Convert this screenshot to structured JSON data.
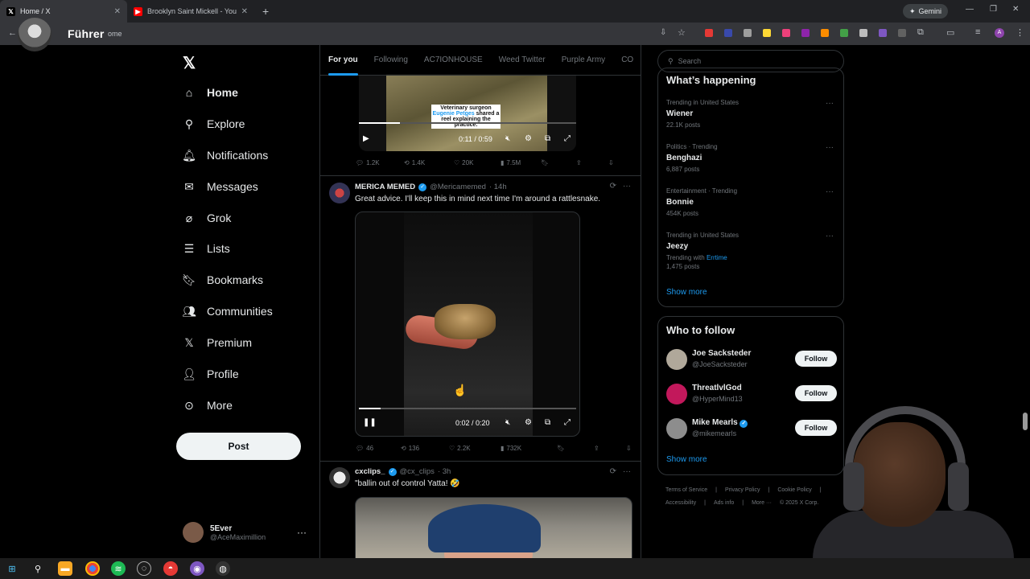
{
  "browser": {
    "tabs": [
      {
        "title": "Home / X",
        "icon": "x-icon"
      },
      {
        "title": "Brooklyn Saint Mickell - YouTub",
        "icon": "youtube-icon"
      }
    ],
    "new_tab": "+",
    "gemini_label": "Gemini",
    "address_text": "ome",
    "overlay_label": "Führer"
  },
  "nav": {
    "items": [
      {
        "label": "Home",
        "icon": "home-icon"
      },
      {
        "label": "Explore",
        "icon": "search-icon"
      },
      {
        "label": "Notifications",
        "icon": "bell-icon"
      },
      {
        "label": "Messages",
        "icon": "mail-icon"
      },
      {
        "label": "Grok",
        "icon": "grok-icon"
      },
      {
        "label": "Lists",
        "icon": "list-icon"
      },
      {
        "label": "Bookmarks",
        "icon": "bookmark-icon"
      },
      {
        "label": "Communities",
        "icon": "people-icon"
      },
      {
        "label": "Premium",
        "icon": "x-icon"
      },
      {
        "label": "Profile",
        "icon": "person-icon"
      },
      {
        "label": "More",
        "icon": "more-circle-icon"
      }
    ],
    "post_label": "Post",
    "account": {
      "name": "5Ever",
      "handle": "@AceMaximillion"
    }
  },
  "feed": {
    "tabs": [
      "For you",
      "Following",
      "AC7IONHOUSE",
      "Weed Twitter",
      "Purple Army",
      "CO"
    ],
    "tweet1": {
      "caption_pre": "Veterinary surgeon ",
      "caption_hl": "Eugenie Petges",
      "caption_post": " shared a reel explaining the practice.",
      "time": "0:11 / 0:59",
      "progress": 0.19,
      "replies": "1.2K",
      "reposts": "1.4K",
      "likes": "20K",
      "views": "7.5M"
    },
    "tweet2": {
      "name": "MERICA MEMED",
      "handle": "@Mericamemed",
      "age": "· 14h",
      "text": "Great advice. I'll keep this in mind next time I'm around a rattlesnake.",
      "time": "0:02 / 0:20",
      "progress": 0.1,
      "replies": "46",
      "reposts": "136",
      "likes": "2.2K",
      "views": "732K"
    },
    "tweet3": {
      "name": "cxclips_",
      "handle": "@cx_clips",
      "age": "· 3h",
      "text": "\"ballin out of control Yatta! 🤣"
    }
  },
  "sidebar": {
    "search_placeholder": "Search",
    "happening_title": "What’s happening",
    "trends": [
      {
        "context": "Trending in United States",
        "name": "Wiener",
        "count": "22.1K posts"
      },
      {
        "context": "Politics · Trending",
        "name": "Benghazi",
        "count": "6,887 posts"
      },
      {
        "context": "Entertainment · Trending",
        "name": "Bonnie",
        "count": "454K posts"
      },
      {
        "context": "Trending in United States",
        "name": "Jeezy",
        "with_label": "Trending with",
        "with_link": "Errtime",
        "count": "1,475 posts"
      }
    ],
    "show_more": "Show more",
    "who_title": "Who to follow",
    "follow_label": "Follow",
    "who": [
      {
        "name": "Joe Sacksteder",
        "handle": "@JoeSacksteder"
      },
      {
        "name": "ThreatlvlGod",
        "handle": "@HyperMind13"
      },
      {
        "name": "Mike Mearls",
        "handle": "@mikemearls"
      }
    ],
    "show_more2": "Show more",
    "footer": [
      "Terms of Service",
      "|",
      "Privacy Policy",
      "|",
      "Cookie Policy",
      "|",
      "Accessibility",
      "|",
      "Ads info",
      "|",
      "More ···",
      "© 2025 X Corp."
    ]
  },
  "colors": {
    "accent": "#1d9bf0",
    "background": "#000000",
    "border": "#2f3336",
    "muted": "#71767b"
  }
}
